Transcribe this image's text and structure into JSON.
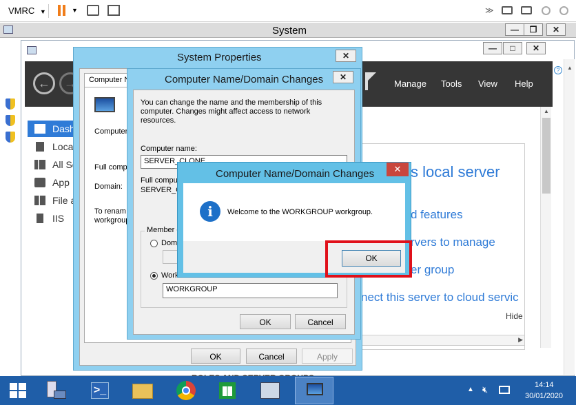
{
  "vmrc": {
    "menu_label": "VMRC",
    "window_title": "System"
  },
  "server_manager": {
    "header_menu": [
      "Manage",
      "Tools",
      "View",
      "Help"
    ],
    "sidebar": [
      "Dash",
      "Local",
      "All Se",
      "App",
      "File a",
      "IIS"
    ],
    "welcome_items": [
      "s local server",
      "d features",
      "rvers to manage",
      "er group",
      "nect this server to cloud servic"
    ],
    "hide_label": "Hide",
    "roles_header": "ROLES AND SERVER GROUPS"
  },
  "system_properties": {
    "title": "System Properties",
    "tab_label": "Computer N",
    "description_fragment": "Computer",
    "full_computer_label": "Full compu",
    "domain_label": "Domain:",
    "rename_text_1": "To renam",
    "rename_text_2": "workgroup",
    "ok_label": "OK",
    "cancel_label": "Cancel",
    "apply_label": "Apply"
  },
  "domain_changes": {
    "title": "Computer Name/Domain Changes",
    "description": "You can change the name and the membership of this computer. Changes might affect access to network resources.",
    "computer_name_label": "Computer name:",
    "computer_name_value": "SERVER_CLONE",
    "full_computer_label": "Full compu",
    "full_computer_value": "SERVER_C",
    "member_of_label": "Member o",
    "domain_radio_label": "Dom",
    "workgroup_radio_label": "Work",
    "workgroup_value": "WORKGROUP",
    "ok_label": "OK",
    "cancel_label": "Cancel"
  },
  "message_box": {
    "title": "Computer Name/Domain Changes",
    "message": "Welcome to the WORKGROUP workgroup.",
    "ok_label": "OK",
    "highlight_color": "#e0101a"
  },
  "taskbar": {
    "time": "14:14",
    "date": "30/01/2020"
  },
  "colors": {
    "dialog_frame": "#7fc8ec",
    "message_frame": "#63c0e6",
    "taskbar": "#1f5ea8",
    "server_header": "#363636"
  }
}
